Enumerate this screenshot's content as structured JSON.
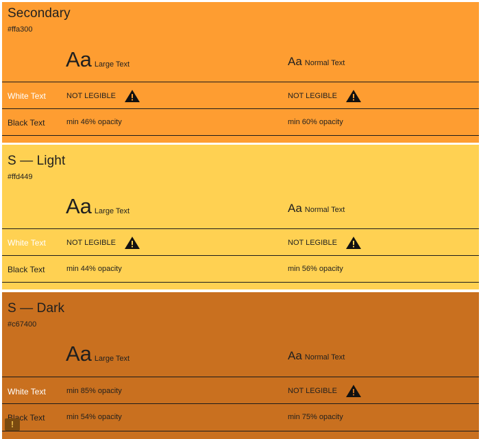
{
  "colors": {
    "secondary": "#ffa300",
    "secondary_render": "#fe9d31",
    "light_render": "#ffd152",
    "dark_render": "#c9701f",
    "white_text": "#ffffff",
    "black_text": "#1f1f1f"
  },
  "sections": [
    {
      "title": "Secondary",
      "hex": "#ffa300",
      "large_aa": "Aa",
      "large_label": "Large Text",
      "normal_aa": "Aa",
      "normal_label": "Normal Text",
      "white_label": "White Text",
      "white_large": "NOT LEGIBLE",
      "white_normal": "NOT LEGIBLE",
      "black_label": "Black Text",
      "black_large": "min 46% opacity",
      "black_normal": "min 60% opacity"
    },
    {
      "title": "S — Light",
      "hex": "#ffd449",
      "large_aa": "Aa",
      "large_label": "Large Text",
      "normal_aa": "Aa",
      "normal_label": "Normal Text",
      "white_label": "White Text",
      "white_large": "NOT LEGIBLE",
      "white_normal": "NOT LEGIBLE",
      "black_label": "Black Text",
      "black_large": "min 44% opacity",
      "black_normal": "min 56% opacity"
    },
    {
      "title": "S — Dark",
      "hex": "#c67400",
      "large_aa": "Aa",
      "large_label": "Large Text",
      "normal_aa": "Aa",
      "normal_label": "Normal Text",
      "white_label": "White Text",
      "white_large": "min 85% opacity",
      "white_normal": "NOT LEGIBLE",
      "black_label": "Black Text",
      "black_large": "min 54% opacity",
      "black_normal": "min 75% opacity"
    }
  ],
  "icons": {
    "warning": "warning-triangle-icon",
    "error_badge": "error-badge-icon"
  },
  "error_badge_symbol": "!"
}
